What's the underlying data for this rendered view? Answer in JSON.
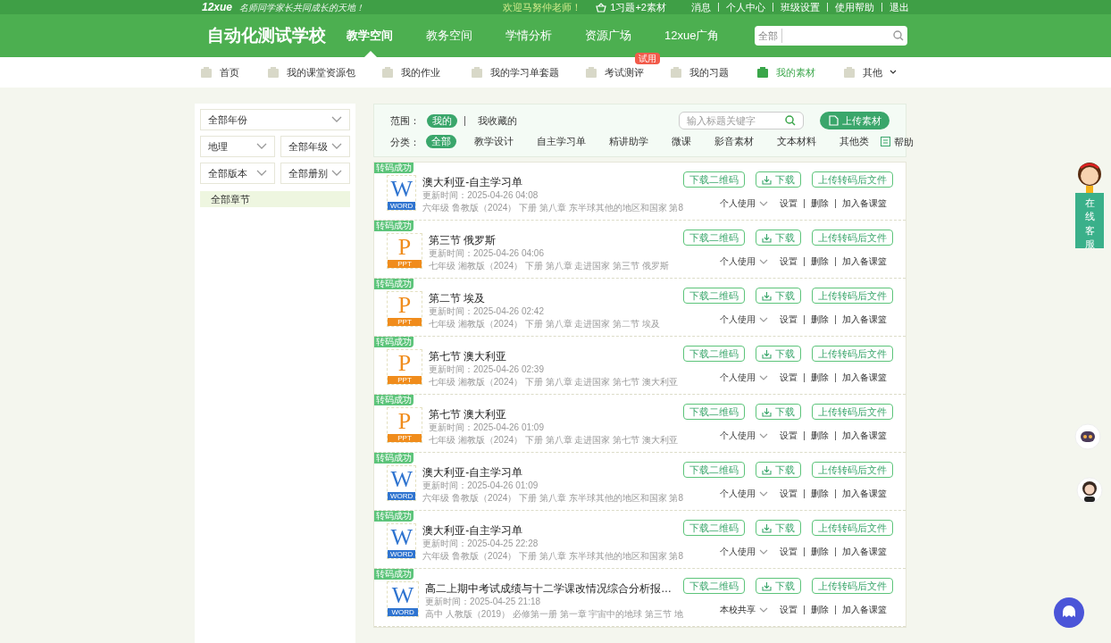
{
  "top_bar": {
    "logo": "12xue",
    "slogan": "名师同学家长共同成长的天地！",
    "welcome": "欢迎马努仲老师！",
    "cart": "1习题+2素材",
    "links": [
      "消息",
      "个人中心",
      "班级设置",
      "使用帮助",
      "退出"
    ]
  },
  "header": {
    "school": "自动化测试学校",
    "nav": [
      {
        "label": "教学空间",
        "selected": true
      },
      {
        "label": "教务空间",
        "selected": false
      },
      {
        "label": "学情分析",
        "selected": false
      },
      {
        "label": "资源广场",
        "selected": false
      },
      {
        "label": "12xue广角",
        "selected": false
      }
    ],
    "search": {
      "scope": "全部"
    }
  },
  "subnav": [
    {
      "label": "首页",
      "selected": false
    },
    {
      "label": "我的课堂资源包",
      "selected": false
    },
    {
      "label": "我的作业",
      "selected": false
    },
    {
      "label": "我的学习单套题",
      "selected": false
    },
    {
      "label": "考试测评",
      "badge": "试用",
      "selected": false
    },
    {
      "label": "我的习题",
      "selected": false
    },
    {
      "label": "我的素材",
      "selected": true
    },
    {
      "label": "其他",
      "selected": false
    }
  ],
  "sidebar": {
    "selects": [
      "全部年份",
      "地理",
      "全部年级",
      "全部版本",
      "全部册别"
    ],
    "chapter": "全部章节"
  },
  "filters": {
    "scope_label": "范围：",
    "scopes": [
      {
        "label": "我的",
        "selected": true
      },
      {
        "label": "我收藏的",
        "selected": false
      }
    ],
    "search_placeholder": "输入标题关键字",
    "upload": "上传素材",
    "category_label": "分类：",
    "categories": [
      {
        "label": "全部",
        "selected": true
      },
      {
        "label": "教学设计",
        "selected": false
      },
      {
        "label": "自主学习单",
        "selected": false
      },
      {
        "label": "精讲助学",
        "selected": false
      },
      {
        "label": "微课",
        "selected": false
      },
      {
        "label": "影音素材",
        "selected": false
      },
      {
        "label": "文本材料",
        "selected": false
      },
      {
        "label": "其他类",
        "selected": false
      }
    ],
    "help": "帮助"
  },
  "items": [
    {
      "badge": "转码成功",
      "kind": "word",
      "letter": "W",
      "type_label": "WORD",
      "title": "澳大利亚-自主学习单",
      "updated": "更新时间：2025-04-26 04:08",
      "meta": "六年级 鲁教版（2024） 下册 第八章 东半球其他的地区和国家 第8",
      "buttons": [
        "下载二维码",
        "下载",
        "上传转码后文件"
      ],
      "share": "个人使用",
      "actions": [
        "设置",
        "删除",
        "加入备课篮"
      ]
    },
    {
      "badge": "转码成功",
      "kind": "ppt",
      "letter": "P",
      "type_label": "PPT",
      "title": "第三节 俄罗斯",
      "updated": "更新时间：2025-04-26 04:06",
      "meta": "七年级 湘教版（2024） 下册 第八章 走进国家 第三节 俄罗斯",
      "buttons": [
        "下载二维码",
        "下载",
        "上传转码后文件"
      ],
      "share": "个人使用",
      "actions": [
        "设置",
        "删除",
        "加入备课篮"
      ]
    },
    {
      "badge": "转码成功",
      "kind": "ppt",
      "letter": "P",
      "type_label": "PPT",
      "title": "第二节 埃及",
      "updated": "更新时间：2025-04-26 02:42",
      "meta": "七年级 湘教版（2024） 下册 第八章 走进国家 第二节 埃及",
      "buttons": [
        "下载二维码",
        "下载",
        "上传转码后文件"
      ],
      "share": "个人使用",
      "actions": [
        "设置",
        "删除",
        "加入备课篮"
      ]
    },
    {
      "badge": "转码成功",
      "kind": "ppt",
      "letter": "P",
      "type_label": "PPT",
      "title": "第七节 澳大利亚",
      "updated": "更新时间：2025-04-26 02:39",
      "meta": "七年级 湘教版（2024） 下册 第八章 走进国家 第七节 澳大利亚",
      "buttons": [
        "下载二维码",
        "下载",
        "上传转码后文件"
      ],
      "share": "个人使用",
      "actions": [
        "设置",
        "删除",
        "加入备课篮"
      ]
    },
    {
      "badge": "转码成功",
      "kind": "ppt",
      "letter": "P",
      "type_label": "PPT",
      "title": "第七节 澳大利亚",
      "updated": "更新时间：2025-04-26 01:09",
      "meta": "七年级 湘教版（2024） 下册 第八章 走进国家 第七节 澳大利亚",
      "buttons": [
        "下载二维码",
        "下载",
        "上传转码后文件"
      ],
      "share": "个人使用",
      "actions": [
        "设置",
        "删除",
        "加入备课篮"
      ]
    },
    {
      "badge": "转码成功",
      "kind": "word",
      "letter": "W",
      "type_label": "WORD",
      "title": "澳大利亚-自主学习单",
      "updated": "更新时间：2025-04-26 01:09",
      "meta": "六年级 鲁教版（2024） 下册 第八章 东半球其他的地区和国家 第8",
      "buttons": [
        "下载二维码",
        "下载",
        "上传转码后文件"
      ],
      "share": "个人使用",
      "actions": [
        "设置",
        "删除",
        "加入备课篮"
      ]
    },
    {
      "badge": "转码成功",
      "kind": "word",
      "letter": "W",
      "type_label": "WORD",
      "title": "澳大利亚-自主学习单",
      "updated": "更新时间：2025-04-25 22:28",
      "meta": "六年级 鲁教版（2024） 下册 第八章 东半球其他的地区和国家 第8",
      "buttons": [
        "下载二维码",
        "下载",
        "上传转码后文件"
      ],
      "share": "个人使用",
      "actions": [
        "设置",
        "删除",
        "加入备课篮"
      ]
    },
    {
      "badge": "转码成功",
      "kind": "word",
      "letter": "W",
      "type_label": "WORD",
      "title": "高二上期中考试成绩与十二学课改情况综合分析报…",
      "updated": "更新时间：2025-04-25 21:18",
      "meta": "高中 人教版（2019） 必修第一册 第一章 宇宙中的地球 第三节 地",
      "buttons": [
        "下载二维码",
        "下载",
        "上传转码后文件"
      ],
      "share": "本校共享",
      "actions": [
        "设置",
        "删除",
        "加入备课篮"
      ]
    }
  ],
  "side": {
    "service": "在线客服"
  }
}
